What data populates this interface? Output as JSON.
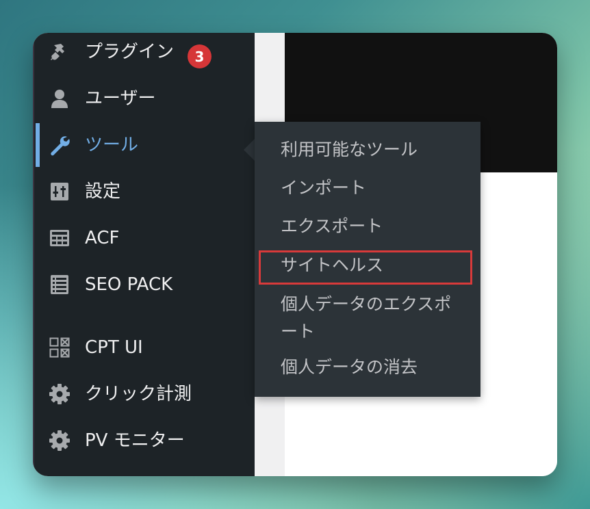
{
  "sidebar": {
    "items": [
      {
        "label": "プラグイン",
        "icon": "plugin-icon",
        "badge": "3"
      },
      {
        "label": "ユーザー",
        "icon": "user-icon"
      },
      {
        "label": "ツール",
        "icon": "wrench-icon",
        "current": true
      },
      {
        "label": "設定",
        "icon": "settings-sliders-icon"
      },
      {
        "label": "ACF",
        "icon": "acf-grid-icon"
      },
      {
        "label": "SEO PACK",
        "icon": "list-icon"
      },
      {
        "label": "CPT UI",
        "icon": "cpt-grid-icon"
      },
      {
        "label": "クリック計測",
        "icon": "gear-icon"
      },
      {
        "label": "PV モニター",
        "icon": "gear-icon"
      }
    ]
  },
  "flyout": {
    "items": [
      {
        "label": "利用可能なツール"
      },
      {
        "label": "インポート"
      },
      {
        "label": "エクスポート"
      },
      {
        "label": "サイトヘルス",
        "highlighted": true
      },
      {
        "label_line1": "個人データのエクスポ",
        "label_line2": "ート"
      },
      {
        "label": "個人データの消去"
      }
    ]
  },
  "colors": {
    "sidebar_bg": "#1d2327",
    "flyout_bg": "#2c3338",
    "current": "#72aee6",
    "badge": "#d63638",
    "highlight_border": "#d83a3a"
  }
}
